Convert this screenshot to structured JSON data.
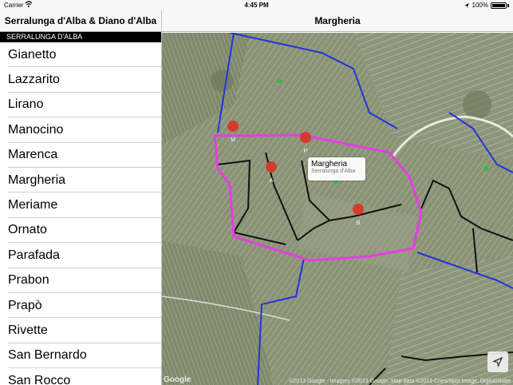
{
  "status": {
    "carrier": "Carrier",
    "time": "4:45 PM",
    "battery": "100%"
  },
  "left_nav": {
    "title": "Serralunga d'Alba & Diano d'Alba"
  },
  "right_nav": {
    "title": "Margheria"
  },
  "section": {
    "title": "SERRALUNGA D'ALBA"
  },
  "list": [
    "Gianetto",
    "Lazzarito",
    "Lirano",
    "Manocino",
    "Marenca",
    "Margheria",
    "Meriame",
    "Ornato",
    "Parafada",
    "Prabon",
    "Prapò",
    "Rivette",
    "San Bernardo",
    "San Rocco"
  ],
  "map": {
    "callout_title": "Margheria",
    "callout_subtitle": "Serralunga d'Alba",
    "pins": [
      "M",
      "P",
      "A",
      "B"
    ],
    "logo": "Google",
    "attribution": "©2013 Google - Imagery ©2013 Google, Map data ©2013 Cnes/Spot Image, DigitalGlobe"
  },
  "colors": {
    "highlight_boundary": "#e63ce6",
    "blue_boundary": "#2233dd",
    "pin": "#d43a2c",
    "green_pin": "#27c23a"
  }
}
